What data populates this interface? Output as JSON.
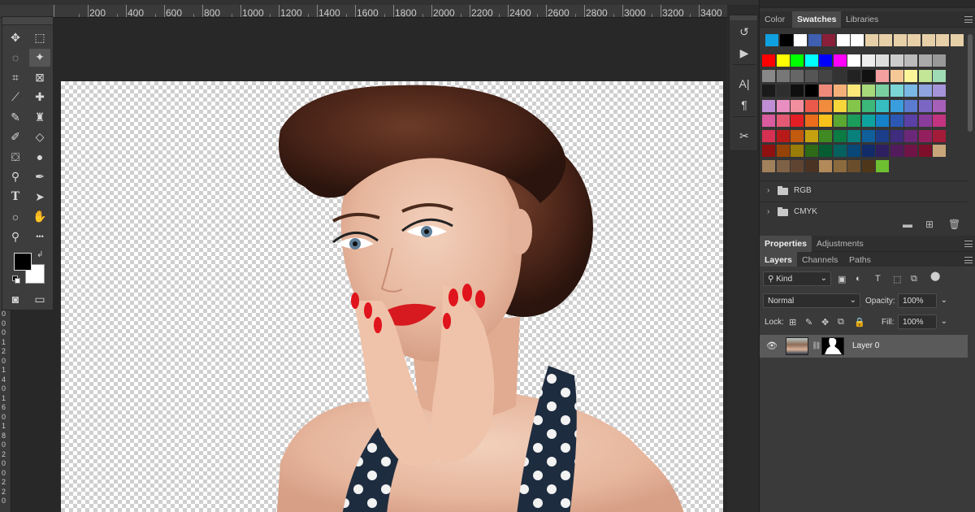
{
  "ruler": {
    "top_ticks": [
      "200",
      "400",
      "600",
      "800",
      "1000",
      "1200",
      "1400",
      "1600",
      "1800",
      "2000",
      "2200",
      "2400",
      "2600",
      "2800",
      "3000",
      "3200",
      "3400"
    ],
    "left_ticks": [
      "0",
      "0",
      "0",
      "1",
      "2",
      "0",
      "1",
      "4",
      "0",
      "1",
      "6",
      "0",
      "1",
      "8",
      "0",
      "2",
      "0",
      "0",
      "2",
      "2",
      "0"
    ]
  },
  "tools": [
    {
      "name": "move-tool-icon",
      "glyph": "✥"
    },
    {
      "name": "marquee-tool-icon",
      "glyph": "⬚"
    },
    {
      "name": "lasso-tool-icon",
      "glyph": "◌"
    },
    {
      "name": "magic-wand-tool-icon",
      "glyph": "✦"
    },
    {
      "name": "crop-tool-icon",
      "glyph": "⌗"
    },
    {
      "name": "frame-tool-icon",
      "glyph": "⊠"
    },
    {
      "name": "eyedropper-tool-icon",
      "glyph": "⟋"
    },
    {
      "name": "healing-brush-tool-icon",
      "glyph": "✚"
    },
    {
      "name": "brush-tool-icon",
      "glyph": "✎"
    },
    {
      "name": "clone-stamp-tool-icon",
      "glyph": "♜"
    },
    {
      "name": "history-brush-tool-icon",
      "glyph": "✐"
    },
    {
      "name": "eraser-tool-icon",
      "glyph": "◇"
    },
    {
      "name": "paint-bucket-tool-icon",
      "glyph": "⛋"
    },
    {
      "name": "blur-tool-icon",
      "glyph": "●"
    },
    {
      "name": "dodge-tool-icon",
      "glyph": "⚲"
    },
    {
      "name": "pen-tool-icon",
      "glyph": "✒"
    },
    {
      "name": "type-tool-icon",
      "glyph": "T"
    },
    {
      "name": "path-selection-tool-icon",
      "glyph": "➤"
    },
    {
      "name": "ellipse-tool-icon",
      "glyph": "○"
    },
    {
      "name": "hand-tool-icon",
      "glyph": "✋"
    },
    {
      "name": "zoom-tool-icon",
      "glyph": "⚲"
    },
    {
      "name": "more-tools-icon",
      "glyph": "•••"
    },
    {
      "name": "quick-mask-icon",
      "glyph": "◙"
    },
    {
      "name": "screen-mode-icon",
      "glyph": "▭"
    }
  ],
  "colors": {
    "foreground": "#000000",
    "background": "#ffffff"
  },
  "midstrip": [
    {
      "name": "history-icon",
      "glyph": "↺"
    },
    {
      "name": "actions-play-icon",
      "glyph": "▶"
    },
    {
      "name": "character-icon",
      "glyph": "A|"
    },
    {
      "name": "paragraph-icon",
      "glyph": "¶"
    },
    {
      "name": "tools-presets-icon",
      "glyph": "✂"
    }
  ],
  "swatch_panel": {
    "tabs": [
      "Color",
      "Swatches",
      "Libraries"
    ],
    "active_tab": "Swatches",
    "recent": [
      "#0fa0e0",
      "#000000",
      "#ffffff",
      "#3f5fb0",
      "#8a1f3a",
      "#ffffff",
      "#ffffff",
      "#e7cfa8",
      "#e7cfa8",
      "#e7cfa8",
      "#e7cfa8",
      "#e7cfa8",
      "#e7cfa8",
      "#e7cfa8"
    ],
    "grid": [
      [
        "#ff0000",
        "#ffff00",
        "#00ff00",
        "#00ffff",
        "#0000ff",
        "#ff00ff",
        "#ffffff",
        "#eeeeee",
        "#dddddd",
        "#cccccc",
        "#bbbbbb",
        "#aaaaaa",
        "#999999"
      ],
      [
        "#888888",
        "#777777",
        "#666666",
        "#555555",
        "#444444",
        "#333333",
        "#222222",
        "#111111",
        "#f4a0a0",
        "#f6c896",
        "#fdf59a",
        "#c3e596",
        "#9fdbb4"
      ],
      [
        "#1a1a1a",
        "#2e2e2e",
        "#0f0f0f",
        "#000000",
        "#ef8a7a",
        "#f5b07a",
        "#fbe77a",
        "#a7d97a",
        "#7acfa0",
        "#7ad5d5",
        "#7ab8e5",
        "#8fa4de",
        "#a594d8"
      ],
      [
        "#c08ed5",
        "#e88ec0",
        "#f28f9e",
        "#ea5a4b",
        "#f08c3c",
        "#f7d63b",
        "#84c54b",
        "#3bb87a",
        "#36bdbf",
        "#3a9edd",
        "#5a7bd0",
        "#7b66c4",
        "#a660b7"
      ],
      [
        "#d85c9e",
        "#e45a74",
        "#e31e24",
        "#eb6c1a",
        "#f7c21a",
        "#5aa832",
        "#1c9c5a",
        "#0fa39f",
        "#1481c8",
        "#2c57b3",
        "#5b40a6",
        "#8a3c9c",
        "#c2347f"
      ],
      [
        "#d63052",
        "#b81a1a",
        "#c25a10",
        "#c5a10f",
        "#3f8a22",
        "#0c7a43",
        "#0a807c",
        "#0e5f9a",
        "#1c3d8a",
        "#3f2c7f",
        "#6b2878",
        "#931f5e",
        "#a41b3a"
      ],
      [
        "#8f1010",
        "#964308",
        "#9a7c08",
        "#2e6a18",
        "#065d32",
        "#06615e",
        "#084776",
        "#122c6a",
        "#2e1f60",
        "#511b5c",
        "#701448",
        "#7d0f2a",
        "#c9a67a"
      ],
      [
        "#a1805c",
        "#7f6146",
        "#5f4531",
        "#4a3322",
        "#b28a5a",
        "#8b6a3e",
        "#6a4e2c",
        "#4e3719",
        "#6fbf32",
        "",
        "",
        "",
        ""
      ]
    ],
    "folders": [
      "RGB",
      "CMYK"
    ]
  },
  "layers_panel": {
    "top_tabs": [
      "Properties",
      "Adjustments"
    ],
    "active_top_tab": "Properties",
    "tabs": [
      "Layers",
      "Channels",
      "Paths"
    ],
    "active_tab": "Layers",
    "filter_label": "Kind",
    "blend_mode": "Normal",
    "opacity_label": "Opacity:",
    "opacity_value": "100%",
    "lock_label": "Lock:",
    "fill_label": "Fill:",
    "fill_value": "100%",
    "layers": [
      {
        "name": "Layer 0",
        "visible": true
      }
    ]
  }
}
